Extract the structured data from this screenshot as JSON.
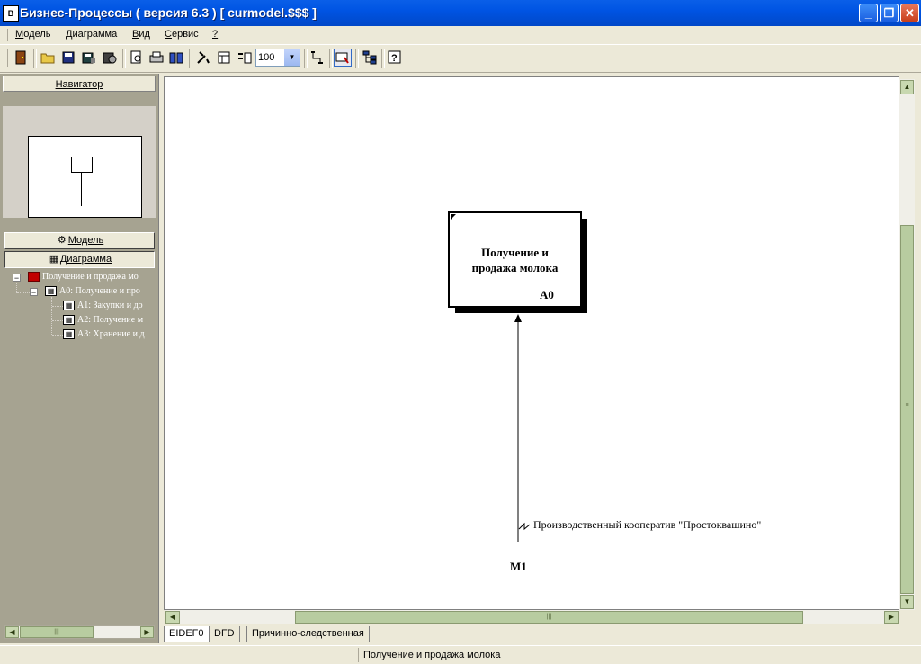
{
  "window": {
    "title": "Бизнес-Процессы ( версия 6.3 ) [ curmodel.$$$ ]",
    "minimize": "_",
    "restore": "❐",
    "close": "✕"
  },
  "menu": [
    {
      "label": "Модель",
      "underline": "М",
      "rest": "одель"
    },
    {
      "label": "Диаграмма",
      "underline": "Д",
      "rest": "иаграмма"
    },
    {
      "label": "Вид",
      "underline": "В",
      "rest": "ид"
    },
    {
      "label": "Сервис",
      "underline": "С",
      "rest": "ервис"
    },
    {
      "label": "?",
      "underline": "?",
      "rest": ""
    }
  ],
  "toolbar": {
    "zoom_value": "100"
  },
  "left_panel": {
    "navigator_label": "Навигатор",
    "model_button": "Модель",
    "diagram_button": "Диаграмма",
    "tree": [
      {
        "label": "Получение и продажа мо",
        "level": 0
      },
      {
        "label": "А0: Получение и про",
        "level": 1
      },
      {
        "label": "А1: Закупки и до",
        "level": 2
      },
      {
        "label": "А2: Получение м",
        "level": 2
      },
      {
        "label": "А3: Хранение и д",
        "level": 2
      }
    ]
  },
  "diagram": {
    "box_title_line1": "Получение и",
    "box_title_line2": "продажа молока",
    "box_node": "A0",
    "mechanism_label": "Производственный кооператив \"Простоквашино\"",
    "mechanism_code": "M1"
  },
  "tabs": [
    {
      "label": "EIDEF0",
      "active": true
    },
    {
      "label": "DFD",
      "active": false
    },
    {
      "label": "Причинно-следственная",
      "active": false
    }
  ],
  "status": {
    "text": "Получение и продажа молока"
  }
}
